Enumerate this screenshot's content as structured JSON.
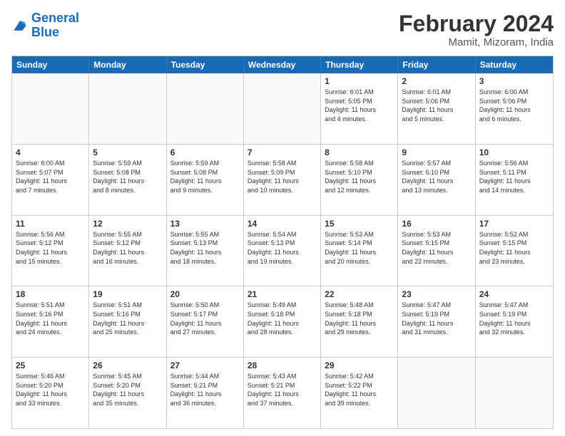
{
  "header": {
    "logo_general": "General",
    "logo_blue": "Blue",
    "title": "February 2024",
    "subtitle": "Mamit, Mizoram, India"
  },
  "calendar": {
    "days": [
      "Sunday",
      "Monday",
      "Tuesday",
      "Wednesday",
      "Thursday",
      "Friday",
      "Saturday"
    ],
    "weeks": [
      [
        {
          "day": "",
          "info": ""
        },
        {
          "day": "",
          "info": ""
        },
        {
          "day": "",
          "info": ""
        },
        {
          "day": "",
          "info": ""
        },
        {
          "day": "1",
          "info": "Sunrise: 6:01 AM\nSunset: 5:05 PM\nDaylight: 11 hours\nand 4 minutes."
        },
        {
          "day": "2",
          "info": "Sunrise: 6:01 AM\nSunset: 5:06 PM\nDaylight: 11 hours\nand 5 minutes."
        },
        {
          "day": "3",
          "info": "Sunrise: 6:00 AM\nSunset: 5:06 PM\nDaylight: 11 hours\nand 6 minutes."
        }
      ],
      [
        {
          "day": "4",
          "info": "Sunrise: 6:00 AM\nSunset: 5:07 PM\nDaylight: 11 hours\nand 7 minutes."
        },
        {
          "day": "5",
          "info": "Sunrise: 5:59 AM\nSunset: 5:08 PM\nDaylight: 11 hours\nand 8 minutes."
        },
        {
          "day": "6",
          "info": "Sunrise: 5:59 AM\nSunset: 5:08 PM\nDaylight: 11 hours\nand 9 minutes."
        },
        {
          "day": "7",
          "info": "Sunrise: 5:58 AM\nSunset: 5:09 PM\nDaylight: 11 hours\nand 10 minutes."
        },
        {
          "day": "8",
          "info": "Sunrise: 5:58 AM\nSunset: 5:10 PM\nDaylight: 11 hours\nand 12 minutes."
        },
        {
          "day": "9",
          "info": "Sunrise: 5:57 AM\nSunset: 5:10 PM\nDaylight: 11 hours\nand 13 minutes."
        },
        {
          "day": "10",
          "info": "Sunrise: 5:56 AM\nSunset: 5:11 PM\nDaylight: 11 hours\nand 14 minutes."
        }
      ],
      [
        {
          "day": "11",
          "info": "Sunrise: 5:56 AM\nSunset: 5:12 PM\nDaylight: 11 hours\nand 15 minutes."
        },
        {
          "day": "12",
          "info": "Sunrise: 5:55 AM\nSunset: 5:12 PM\nDaylight: 11 hours\nand 16 minutes."
        },
        {
          "day": "13",
          "info": "Sunrise: 5:55 AM\nSunset: 5:13 PM\nDaylight: 11 hours\nand 18 minutes."
        },
        {
          "day": "14",
          "info": "Sunrise: 5:54 AM\nSunset: 5:13 PM\nDaylight: 11 hours\nand 19 minutes."
        },
        {
          "day": "15",
          "info": "Sunrise: 5:53 AM\nSunset: 5:14 PM\nDaylight: 11 hours\nand 20 minutes."
        },
        {
          "day": "16",
          "info": "Sunrise: 5:53 AM\nSunset: 5:15 PM\nDaylight: 11 hours\nand 22 minutes."
        },
        {
          "day": "17",
          "info": "Sunrise: 5:52 AM\nSunset: 5:15 PM\nDaylight: 11 hours\nand 23 minutes."
        }
      ],
      [
        {
          "day": "18",
          "info": "Sunrise: 5:51 AM\nSunset: 5:16 PM\nDaylight: 11 hours\nand 24 minutes."
        },
        {
          "day": "19",
          "info": "Sunrise: 5:51 AM\nSunset: 5:16 PM\nDaylight: 11 hours\nand 25 minutes."
        },
        {
          "day": "20",
          "info": "Sunrise: 5:50 AM\nSunset: 5:17 PM\nDaylight: 11 hours\nand 27 minutes."
        },
        {
          "day": "21",
          "info": "Sunrise: 5:49 AM\nSunset: 5:18 PM\nDaylight: 11 hours\nand 28 minutes."
        },
        {
          "day": "22",
          "info": "Sunrise: 5:48 AM\nSunset: 5:18 PM\nDaylight: 11 hours\nand 29 minutes."
        },
        {
          "day": "23",
          "info": "Sunrise: 5:47 AM\nSunset: 5:19 PM\nDaylight: 11 hours\nand 31 minutes."
        },
        {
          "day": "24",
          "info": "Sunrise: 5:47 AM\nSunset: 5:19 PM\nDaylight: 11 hours\nand 32 minutes."
        }
      ],
      [
        {
          "day": "25",
          "info": "Sunrise: 5:46 AM\nSunset: 5:20 PM\nDaylight: 11 hours\nand 33 minutes."
        },
        {
          "day": "26",
          "info": "Sunrise: 5:45 AM\nSunset: 5:20 PM\nDaylight: 11 hours\nand 35 minutes."
        },
        {
          "day": "27",
          "info": "Sunrise: 5:44 AM\nSunset: 5:21 PM\nDaylight: 11 hours\nand 36 minutes."
        },
        {
          "day": "28",
          "info": "Sunrise: 5:43 AM\nSunset: 5:21 PM\nDaylight: 11 hours\nand 37 minutes."
        },
        {
          "day": "29",
          "info": "Sunrise: 5:42 AM\nSunset: 5:22 PM\nDaylight: 11 hours\nand 39 minutes."
        },
        {
          "day": "",
          "info": ""
        },
        {
          "day": "",
          "info": ""
        }
      ]
    ]
  }
}
